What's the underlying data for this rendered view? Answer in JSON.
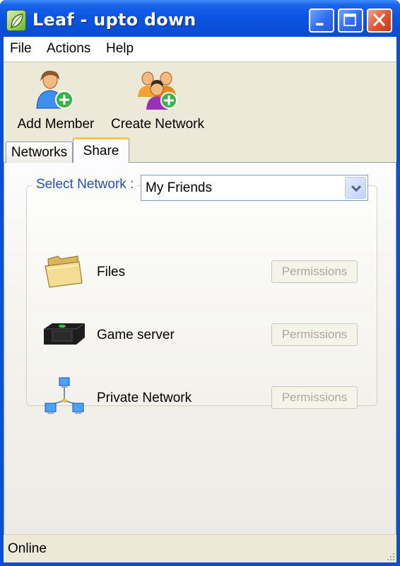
{
  "window": {
    "title": "Leaf - upto down",
    "controls": [
      "minimize-icon",
      "maximize-icon",
      "close-icon"
    ]
  },
  "menu": {
    "items": [
      "File",
      "Actions",
      "Help"
    ]
  },
  "toolbar": {
    "add_member_label": "Add Member",
    "create_network_label": "Create Network"
  },
  "tabs": [
    {
      "label": "Networks",
      "active": false
    },
    {
      "label": "Share",
      "active": true
    }
  ],
  "share": {
    "select_label": "Select Network :",
    "selected_network": "My Friends",
    "items": [
      {
        "label": "Files",
        "icon": "folder-icon",
        "button": "Permissions"
      },
      {
        "label": "Game server",
        "icon": "game-console-icon",
        "button": "Permissions"
      },
      {
        "label": "Private Network",
        "icon": "network-icon",
        "button": "Permissions"
      }
    ]
  },
  "status": {
    "text": "Online"
  },
  "colors": {
    "titlebar": "#0b55e3",
    "legend_text": "#2450b5",
    "active_tab_accent": "#ffc83c",
    "disabled_text": "#aca899"
  }
}
